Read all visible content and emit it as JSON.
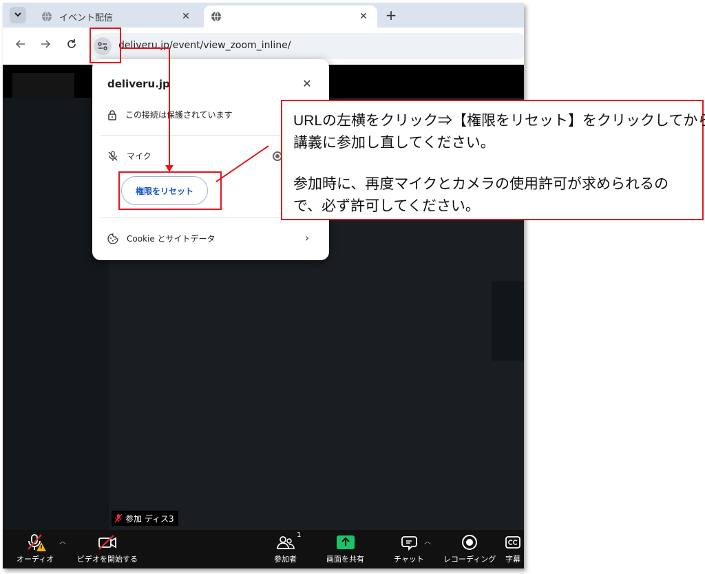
{
  "browser": {
    "tabs": [
      {
        "title": "イベント配信",
        "close": "✕"
      },
      {
        "title": "",
        "close": "✕"
      }
    ],
    "new_tab": "+",
    "url": "deliveru.jp/event/view_zoom_inline/"
  },
  "site_info_popup": {
    "domain": "deliveru.jp",
    "connection_label": "この接続は保護されています",
    "mic_label": "マイク",
    "reset_button_label": "権限をリセット",
    "cookie_label": "Cookie とサイトデータ"
  },
  "zoom": {
    "participant_name": "参加 ディス3",
    "toolbar": {
      "audio": "オーディオ",
      "video": "ビデオを開始する",
      "participants": "参加者",
      "participants_count": "1",
      "share": "画面を共有",
      "chat": "チャット",
      "record": "レコーディング",
      "captions": "字幕"
    }
  },
  "annotation": {
    "lines": [
      "URLの左横をクリック⇒【権限をリセット】をクリックしてから、",
      "講義に参加し直してください。",
      "参加時に、再度マイクとカメラの使用許可が求められるの",
      "で、必ず許可してください。"
    ],
    "color": "#e4151b"
  },
  "colors": {
    "share_green": "#19c36b",
    "reset_blue": "#1a57c8"
  }
}
